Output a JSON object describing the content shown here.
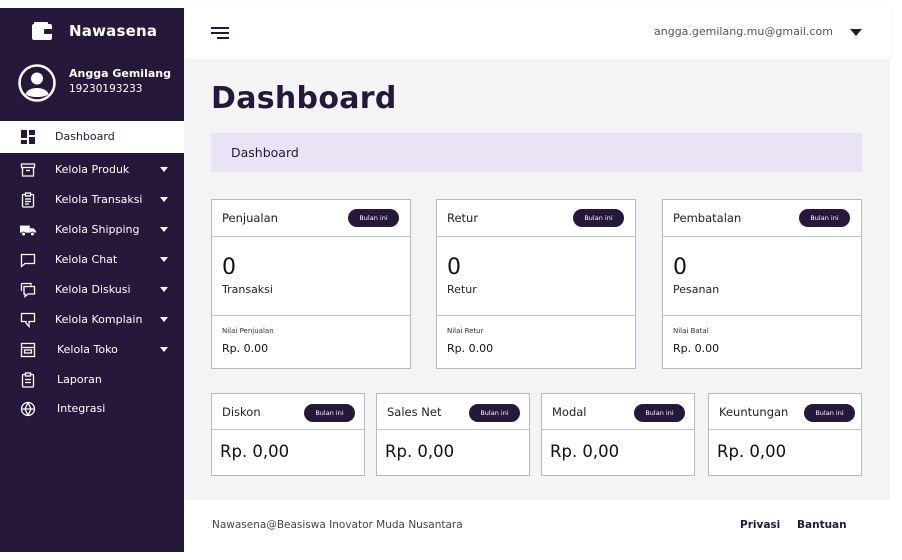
{
  "brand": {
    "name": "Nawasena"
  },
  "user": {
    "name": "Angga Gemilang",
    "id": "19230193233",
    "email": "angga.gemilang.mu@gmail.com"
  },
  "sidebar": {
    "items": [
      {
        "label": "Dashboard",
        "icon": "dashboard-grid-icon"
      },
      {
        "label": "Kelola Produk",
        "icon": "archive-box-icon"
      },
      {
        "label": "Kelola Transaksi",
        "icon": "clipboard-list-icon"
      },
      {
        "label": "Kelola Shipping",
        "icon": "truck-icon"
      },
      {
        "label": "Kelola Chat",
        "icon": "chat-bubble-icon"
      },
      {
        "label": "Kelola Diskusi",
        "icon": "discussion-icon"
      },
      {
        "label": "Kelola Komplain",
        "icon": "complaint-icon"
      },
      {
        "label": "Kelola Toko",
        "icon": "store-icon"
      },
      {
        "label": "Laporan",
        "icon": "report-icon"
      },
      {
        "label": "Integrasi",
        "icon": "integration-icon"
      }
    ]
  },
  "main": {
    "title": "Dashboard",
    "breadcrumb": "Dashboard",
    "badge_label": "Bulan ini",
    "top_cards": [
      {
        "title": "Penjualan",
        "count": "0",
        "unit": "Transaksi",
        "value_label": "Nilai Penjualan",
        "value": "Rp. 0.00"
      },
      {
        "title": "Retur",
        "count": "0",
        "unit": "Retur",
        "value_label": "Nilai Retur",
        "value": "Rp. 0.00"
      },
      {
        "title": "Pembatalan",
        "count": "0",
        "unit": "Pesanan",
        "value_label": "Nilai Batal",
        "value": "Rp. 0.00"
      }
    ],
    "bottom_cards": [
      {
        "title": "Diskon",
        "value": "Rp. 0,00"
      },
      {
        "title": "Sales Net",
        "value": "Rp. 0,00"
      },
      {
        "title": "Modal",
        "value": "Rp. 0,00"
      },
      {
        "title": "Keuntungan",
        "value": "Rp. 0,00"
      }
    ]
  },
  "footer": {
    "copyright": "Nawasena@Beasiswa Inovator Muda Nusantara",
    "links": [
      "Privasi",
      "Bantuan"
    ]
  },
  "colors": {
    "sidebar": "#25183b",
    "breadcrumb_bg": "#e9e3f5",
    "content_bg": "#f4f4f6"
  }
}
